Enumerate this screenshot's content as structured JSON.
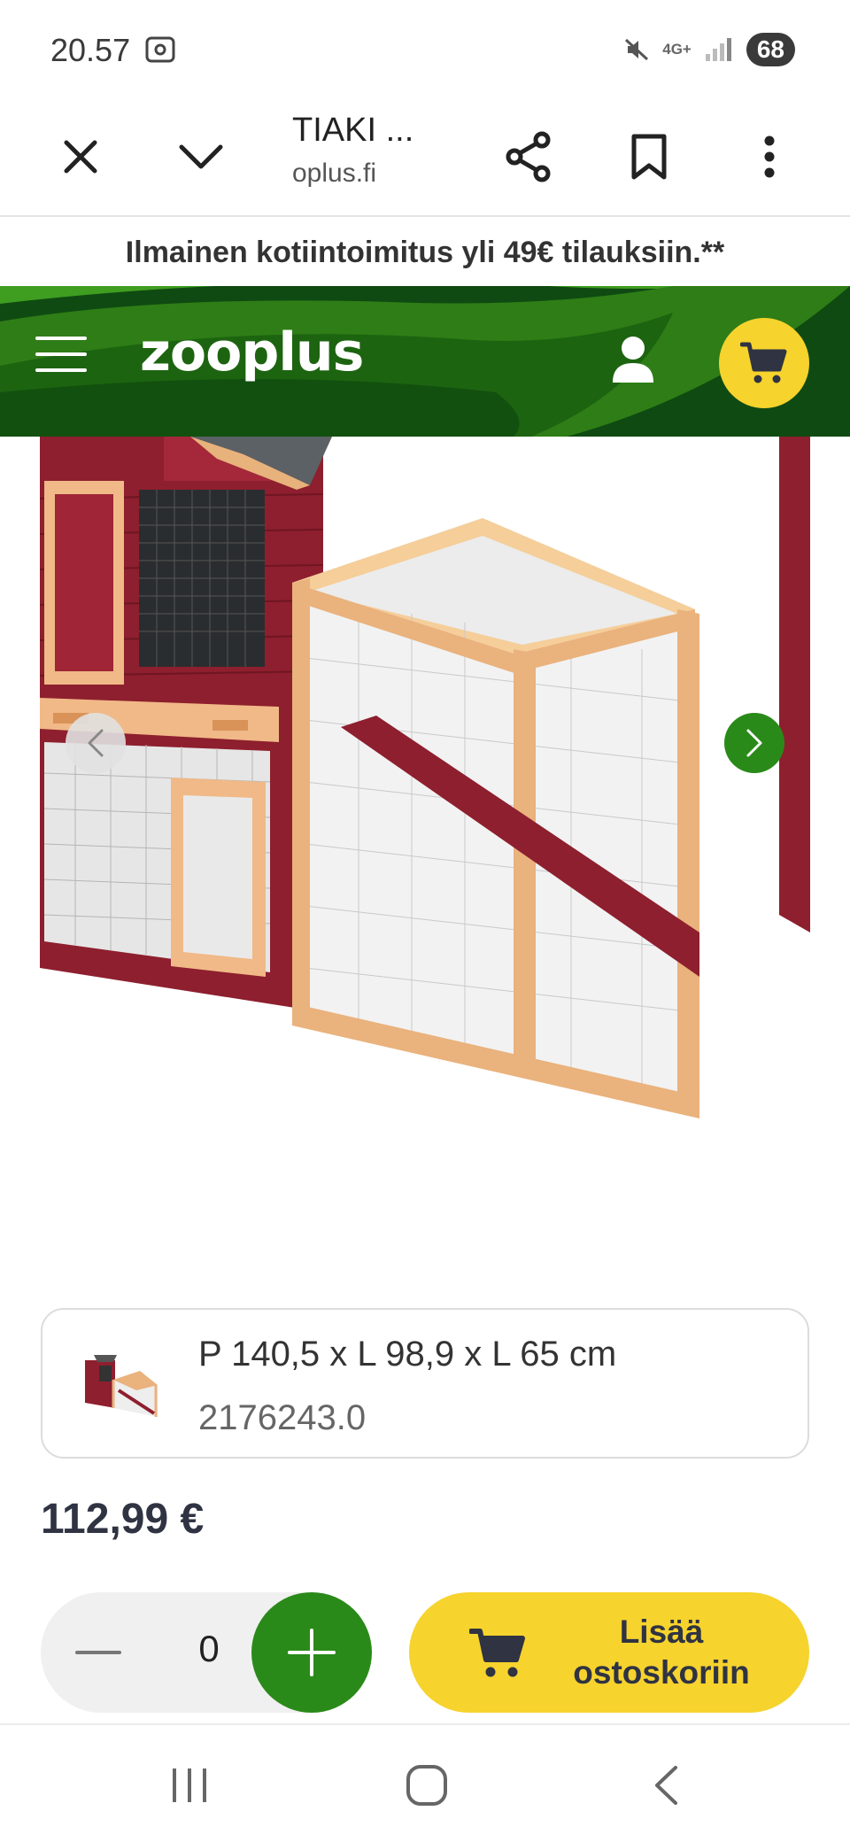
{
  "status_bar": {
    "time": "20.57",
    "network": "4G+",
    "battery": "68"
  },
  "browser": {
    "title": "TIAKI ...",
    "domain": "oplus.fi"
  },
  "promo": {
    "text": "Ilmainen kotiintoimitus yli 49€ tilauksiin.**"
  },
  "header": {
    "logo": "zooplus"
  },
  "variant": {
    "size": "P 140,5 x L 98,9 x L 65 cm",
    "code": "2176243.0"
  },
  "price": "112,99 €",
  "quantity": {
    "value": "0"
  },
  "add_to_cart": {
    "line1": "Lisää",
    "line2": "ostoskoriin"
  },
  "colors": {
    "brand_green": "#2a8a19",
    "header_dark_green": "#0f4a12",
    "accent_yellow": "#f6d32d",
    "price_text": "#2f3342"
  },
  "icons": [
    "close-icon",
    "chevron-down-icon",
    "share-icon",
    "bookmark-icon",
    "more-vert-icon",
    "menu-icon",
    "user-icon",
    "cart-icon",
    "chevron-left-icon",
    "chevron-right-icon",
    "minus-icon",
    "plus-icon",
    "recents-icon",
    "home-icon",
    "back-icon"
  ]
}
